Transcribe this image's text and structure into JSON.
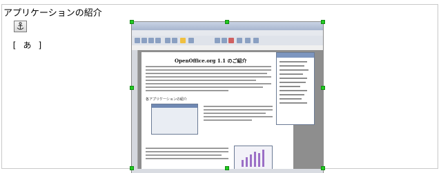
{
  "heading": "アプリケーションの紹介",
  "anchor_icon": "anchor-icon",
  "ime_indicator": "[ あ ]",
  "screenshot": {
    "doc_title": "OpenOffice.org 1.1 のご紹介",
    "section_label": "各アプリケーションの紹介"
  },
  "colors": {
    "handle": "#22cc22",
    "frame_border": "#c8c8c8"
  }
}
